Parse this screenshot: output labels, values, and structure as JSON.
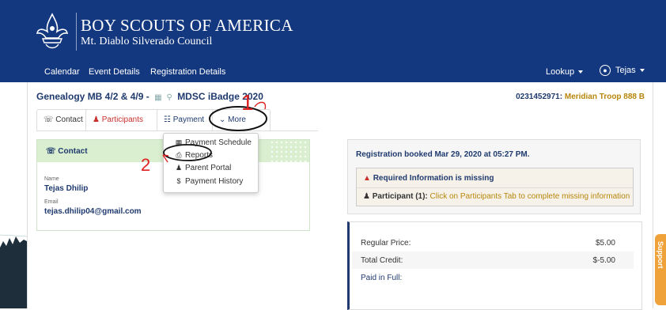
{
  "brand": {
    "title": "BOY SCOUTS OF AMERICA",
    "subtitle": "Mt. Diablo Silverado Council"
  },
  "nav": {
    "calendar": "Calendar",
    "event_details": "Event Details",
    "registration_details": "Registration Details",
    "lookup": "Lookup",
    "user": "Tejas"
  },
  "event": {
    "title_part1": "Genealogy MB 4/2 & 4/9 -",
    "title_part2": "MDSC iBadge 2020",
    "troop_id": "0231452971:",
    "troop_name": "Meridian Troop 888 B"
  },
  "tabs": {
    "contact": "Contact",
    "participants": "Participants",
    "payment": "Payment",
    "more": "More"
  },
  "more_menu": {
    "payment_schedule": "Payment Schedule",
    "reports": "Reports",
    "parent_portal": "Parent Portal",
    "payment_history": "Payment History"
  },
  "contact": {
    "title": "Contact",
    "name_label": "Name",
    "name": "Tejas Dhilip",
    "email_label": "Email",
    "email": "tejas.dhilip04@gmail.com"
  },
  "registration": {
    "booked": "Registration booked Mar 29, 2020 at 05:27 PM.",
    "required_title": "Required Information is missing",
    "participant_label": "Participant (1):",
    "participant_msg": "Click on Participants Tab to complete missing information"
  },
  "pricing": {
    "regular_label": "Regular Price:",
    "regular_value": "$5.00",
    "credit_label": "Total Credit:",
    "credit_value": "$-5.00",
    "paid_label": "Paid in Full:"
  },
  "support": {
    "label": "Support"
  },
  "annotations": {
    "one": "1",
    "two": "2"
  },
  "colors": {
    "header_bg": "#14387f",
    "contact_head": "#d9efcf",
    "accent_gold": "#b8860b",
    "support_orange": "#f0a23a"
  }
}
